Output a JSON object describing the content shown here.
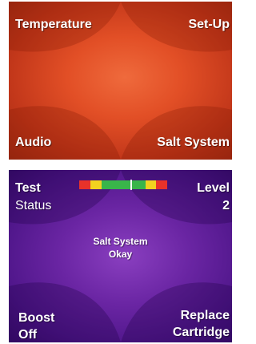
{
  "top_screen": {
    "temperature_label": "Temperature",
    "setup_label": "Set-Up",
    "audio_label": "Audio",
    "salt_system_label": "Salt System",
    "background_color": "#e24f26"
  },
  "bottom_screen": {
    "test_label": "Test",
    "status_label": "Status",
    "level_label": "Level",
    "level_value": "2",
    "status_line1": "Salt System",
    "status_line2": "Okay",
    "boost_label": "Boost",
    "boost_value": "Off",
    "replace_label": "Replace",
    "cartridge_label": "Cartridge",
    "background_color": "#6a25a3",
    "level_meter": {
      "segments": [
        "#e8322a",
        "#f2d21f",
        "#39b54a",
        "#39b54a",
        "#39b54a",
        "#39b54a",
        "#f2d21f",
        "#e8322a"
      ],
      "marker_position_fraction": 0.58
    }
  }
}
